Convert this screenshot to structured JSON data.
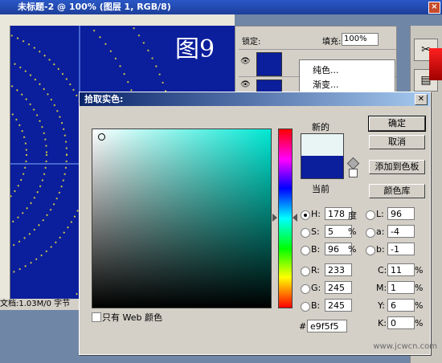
{
  "document": {
    "title": "未标题-2 @ 100% (图层 1, RGB/8)",
    "figure_label": "图9",
    "status": "文档:1.03M/0 字节",
    "ruler_marks": [
      "6",
      "8",
      "1",
      "1",
      "1",
      "1"
    ]
  },
  "layers_panel": {
    "lock_label": "锁定:",
    "fill_label": "填充:",
    "fill_value": "100%"
  },
  "context_menu": {
    "items": [
      "纯色...",
      "渐变..."
    ]
  },
  "dialog": {
    "title": "拾取实色:",
    "new_label": "新的",
    "current_label": "当前",
    "new_color": "#e9f5f5",
    "current_color": "#0b1e9b",
    "buttons": {
      "ok": "确定",
      "cancel": "取消",
      "add_swatch": "添加到色板",
      "libraries": "颜色库"
    },
    "hsb": {
      "h_label": "H:",
      "h_value": "178",
      "h_unit": "度",
      "s_label": "S:",
      "s_value": "5",
      "s_unit": "%",
      "b_label": "B:",
      "b_value": "96",
      "b_unit": "%"
    },
    "lab": {
      "l_label": "L:",
      "l_value": "96",
      "a_label": "a:",
      "a_value": "-4",
      "b_label": "b:",
      "b_value": "-1"
    },
    "rgb": {
      "r_label": "R:",
      "r_value": "233",
      "g_label": "G:",
      "g_value": "245",
      "b_label": "B:",
      "b_value": "245"
    },
    "cmyk": {
      "c_label": "C:",
      "c_value": "11",
      "c_unit": "%",
      "m_label": "M:",
      "m_value": "1",
      "m_unit": "%",
      "y_label": "Y:",
      "y_value": "6",
      "y_unit": "%",
      "k_label": "K:",
      "k_value": "0",
      "k_unit": "%"
    },
    "hex_label": "#",
    "hex_value": "e9f5f5",
    "web_only_label": "只有 Web 颜色"
  },
  "watermark": "www.jcwcn.com"
}
